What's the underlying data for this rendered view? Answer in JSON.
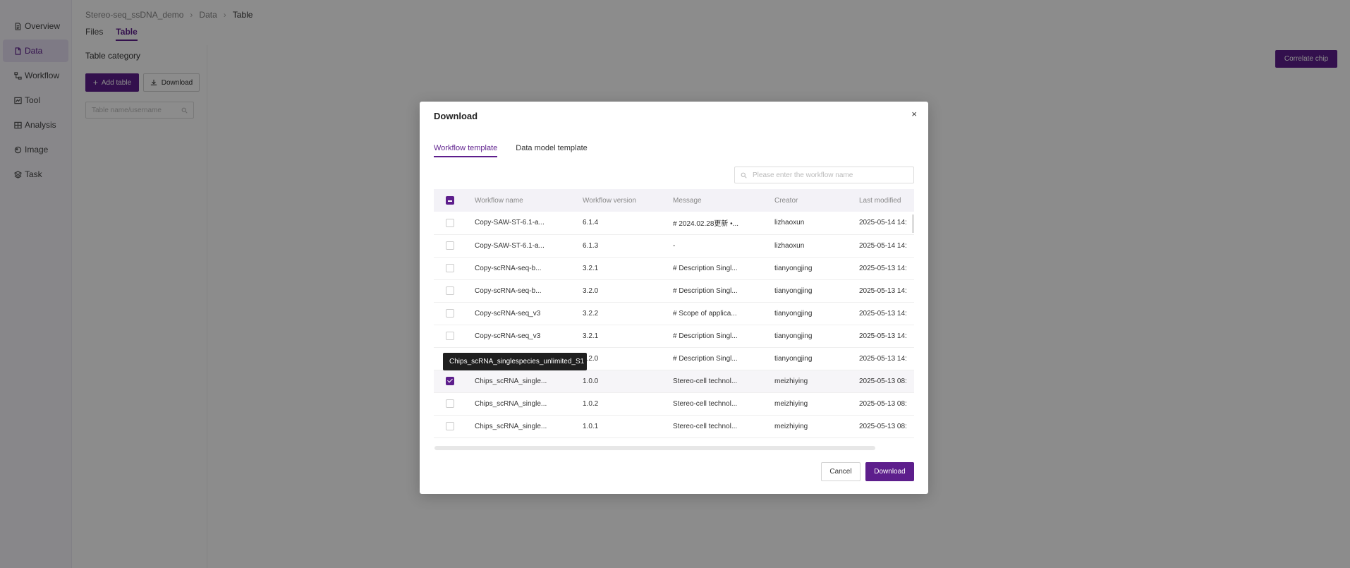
{
  "sidebar": {
    "items": [
      {
        "label": "Overview",
        "icon": "document-icon"
      },
      {
        "label": "Data",
        "icon": "file-icon",
        "active": true
      },
      {
        "label": "Workflow",
        "icon": "workflow-icon"
      },
      {
        "label": "Tool",
        "icon": "tool-icon"
      },
      {
        "label": "Analysis",
        "icon": "analysis-icon"
      },
      {
        "label": "Image",
        "icon": "image-icon"
      },
      {
        "label": "Task",
        "icon": "layers-icon"
      }
    ]
  },
  "breadcrumb": {
    "project": "Stereo-seq_ssDNA_demo",
    "section": "Data",
    "page": "Table"
  },
  "tabs": {
    "files": "Files",
    "table": "Table"
  },
  "panel": {
    "title": "Table category",
    "add_table": "Add table",
    "download": "Download",
    "search_placeholder": "Table name/username"
  },
  "correlate_chip": "Correlate chip",
  "modal": {
    "title": "Download",
    "close": "×",
    "tabs": {
      "workflow": "Workflow template",
      "data_model": "Data model template"
    },
    "search_placeholder": "Please enter the workflow name",
    "columns": {
      "name": "Workflow name",
      "version": "Workflow version",
      "message": "Message",
      "creator": "Creator",
      "modified": "Last modified"
    },
    "rows": [
      {
        "name": "Copy-SAW-ST-6.1-a...",
        "version": "6.1.4",
        "message": "# 2024.02.28更新 •...",
        "creator": "lizhaoxun",
        "modified": "2025-05-14 14:",
        "checked": false
      },
      {
        "name": "Copy-SAW-ST-6.1-a...",
        "version": "6.1.3",
        "message": "-",
        "creator": "lizhaoxun",
        "modified": "2025-05-14 14:",
        "checked": false
      },
      {
        "name": "Copy-scRNA-seq-b...",
        "version": "3.2.1",
        "message": "# Description Singl...",
        "creator": "tianyongjing",
        "modified": "2025-05-13 14:",
        "checked": false
      },
      {
        "name": "Copy-scRNA-seq-b...",
        "version": "3.2.0",
        "message": "# Description Singl...",
        "creator": "tianyongjing",
        "modified": "2025-05-13 14:",
        "checked": false
      },
      {
        "name": "Copy-scRNA-seq_v3",
        "version": "3.2.2",
        "message": "# Scope of applica...",
        "creator": "tianyongjing",
        "modified": "2025-05-13 14:",
        "checked": false
      },
      {
        "name": "Copy-scRNA-seq_v3",
        "version": "3.2.1",
        "message": "# Description Singl...",
        "creator": "tianyongjing",
        "modified": "2025-05-13 14:",
        "checked": false
      },
      {
        "name": "",
        "version": "3.2.0",
        "message": "# Description Singl...",
        "creator": "tianyongjing",
        "modified": "2025-05-13 14:",
        "checked": false
      },
      {
        "name": "Chips_scRNA_single...",
        "version": "1.0.0",
        "message": "Stereo-cell technol...",
        "creator": "meizhiying",
        "modified": "2025-05-13 08:",
        "checked": true
      },
      {
        "name": "Chips_scRNA_single...",
        "version": "1.0.2",
        "message": "Stereo-cell technol...",
        "creator": "meizhiying",
        "modified": "2025-05-13 08:",
        "checked": false
      },
      {
        "name": "Chips_scRNA_single...",
        "version": "1.0.1",
        "message": "Stereo-cell technol...",
        "creator": "meizhiying",
        "modified": "2025-05-13 08:",
        "checked": false
      }
    ],
    "tooltip": "Chips_scRNA_singlespecies_unlimited_S1",
    "cancel": "Cancel",
    "download": "Download"
  }
}
